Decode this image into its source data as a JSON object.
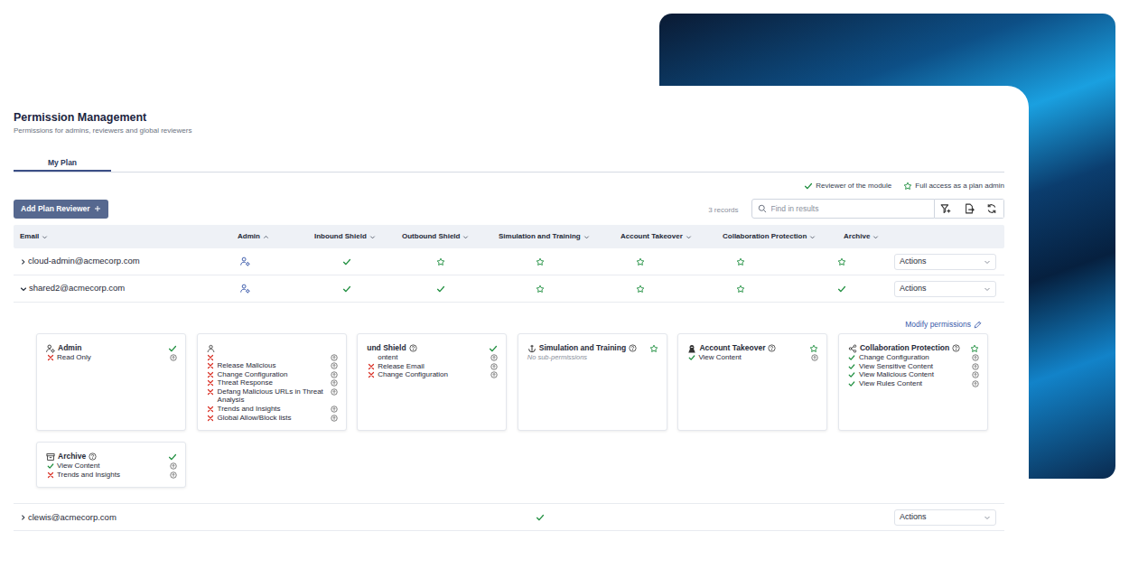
{
  "page": {
    "title": "Permission Management",
    "subtitle": "Permissions for admins, reviewers and global reviewers"
  },
  "tabs": [
    {
      "label": "My Plan",
      "selected": true
    }
  ],
  "legend": [
    {
      "kind": "reviewer",
      "label": "Reviewer of the module"
    },
    {
      "kind": "admin",
      "label": "Full access as a plan admin"
    }
  ],
  "toolbar": {
    "add_button": "Add Plan Reviewer",
    "records": "3 records",
    "search": {
      "placeholder": "Find in results"
    }
  },
  "table": {
    "columns": [
      {
        "label": "Email",
        "sorted": false
      },
      {
        "label": "Admin",
        "sorted": true
      },
      {
        "label": "Inbound Shield",
        "sorted": false
      },
      {
        "label": "Outbound Shield",
        "sorted": false
      },
      {
        "label": "Simulation and Training",
        "sorted": false
      },
      {
        "label": "Account Takeover",
        "sorted": false
      },
      {
        "label": "Collaboration Protection",
        "sorted": false
      },
      {
        "label": "Archive",
        "sorted": false
      }
    ],
    "rows": [
      {
        "email": "cloud-admin@acmecorp.com",
        "expanded": false,
        "admin": true,
        "cells": [
          "reviewer",
          "admin",
          "admin",
          "admin",
          "admin",
          "admin"
        ],
        "actions": "Actions"
      },
      {
        "email": "shared2@acmecorp.com",
        "expanded": true,
        "admin": true,
        "cells": [
          "reviewer",
          "reviewer",
          "admin",
          "admin",
          "admin",
          "reviewer"
        ],
        "actions": "Actions",
        "details": {
          "link": "Modify permissions",
          "cards": [
            {
              "kind": "admin",
              "title": "Admin",
              "access": "reviewer",
              "items": [
                {
                  "label": "Read Only",
                  "kind": "deny"
                }
              ]
            },
            {
              "kind": "inbound",
              "items": [
                {
                  "label": "",
                  "kind": "deny"
                },
                {
                  "label": "Release Malicious",
                  "kind": "deny"
                },
                {
                  "label": "Change Configuration",
                  "kind": "deny"
                },
                {
                  "label": "Threat Response",
                  "kind": "deny"
                },
                {
                  "label": "Defang Malicious URLs in Threat Analysis",
                  "kind": "deny"
                },
                {
                  "label": "Trends and Insights",
                  "kind": "deny"
                },
                {
                  "label": "Global Allow/Block lists",
                  "kind": "deny"
                }
              ]
            },
            {
              "kind": "outbound",
              "title": "und Shield",
              "access": "reviewer",
              "items": [
                {
                  "label": "ontent",
                  "kind": "cut"
                },
                {
                  "label": "Release Email",
                  "kind": "deny"
                },
                {
                  "label": "Change Configuration",
                  "kind": "deny"
                }
              ]
            },
            {
              "kind": "simulation",
              "title": "Simulation and Training",
              "access": "admin",
              "note": "No sub-permissions",
              "items": []
            },
            {
              "kind": "takeover",
              "title": "Account Takeover",
              "access": "admin",
              "items": [
                {
                  "label": "View Content",
                  "kind": "allow"
                }
              ]
            },
            {
              "kind": "collaboration",
              "title": "Collaboration Protection",
              "access": "admin",
              "items": [
                {
                  "label": "Change Configuration",
                  "kind": "allow"
                },
                {
                  "label": "View Sensitive Content",
                  "kind": "allow"
                },
                {
                  "label": "View Malicious Content",
                  "kind": "allow"
                },
                {
                  "label": "View Rules Content",
                  "kind": "allow"
                }
              ]
            },
            {
              "kind": "archive",
              "title": "Archive",
              "access": "reviewer",
              "items": [
                {
                  "label": "View Content",
                  "kind": "allow"
                },
                {
                  "label": "Trends and Insights",
                  "kind": "deny"
                }
              ]
            }
          ]
        }
      },
      {
        "email": "clewis@acmecorp.com",
        "expanded": false,
        "admin": false,
        "cells": [
          "none",
          "none",
          "reviewer",
          "none",
          "none",
          "none"
        ],
        "actions": "Actions"
      }
    ]
  }
}
